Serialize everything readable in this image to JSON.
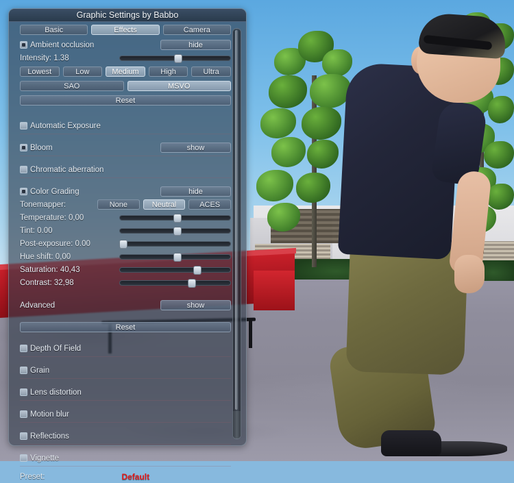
{
  "window": {
    "title": "Graphic Settings by Babbo"
  },
  "tabs": [
    {
      "label": "Basic",
      "active": false
    },
    {
      "label": "Effects",
      "active": true
    },
    {
      "label": "Camera",
      "active": false
    }
  ],
  "ambient_occlusion": {
    "label": "Ambient occlusion",
    "checked": true,
    "toggle_label": "hide",
    "intensity_label": "Intensity: 1.38",
    "intensity_percent": 53,
    "quality": [
      {
        "label": "Lowest",
        "active": false
      },
      {
        "label": "Low",
        "active": false
      },
      {
        "label": "Medium",
        "active": true
      },
      {
        "label": "High",
        "active": false
      },
      {
        "label": "Ultra",
        "active": false
      }
    ],
    "methods": [
      {
        "label": "SAO",
        "active": false
      },
      {
        "label": "MSVO",
        "active": true
      }
    ],
    "reset_label": "Reset"
  },
  "automatic_exposure": {
    "label": "Automatic Exposure",
    "checked": false
  },
  "bloom": {
    "label": "Bloom",
    "checked": true,
    "toggle_label": "show"
  },
  "chromatic_aberration": {
    "label": "Chromatic aberration",
    "checked": false
  },
  "color_grading": {
    "label": "Color Grading",
    "checked": true,
    "toggle_label": "hide",
    "tonemapper_label": "Tonemapper:",
    "tonemappers": [
      {
        "label": "None",
        "active": false
      },
      {
        "label": "Neutral",
        "active": true
      },
      {
        "label": "ACES",
        "active": false
      }
    ],
    "sliders": [
      {
        "label": "Temperature: 0,00",
        "percent": 52
      },
      {
        "label": "Tint: 0.00",
        "percent": 52
      },
      {
        "label": "Post-exposure: 0.00",
        "percent": 3
      },
      {
        "label": "Hue shift: 0,00",
        "percent": 52
      },
      {
        "label": "Saturation: 40,43",
        "percent": 70
      },
      {
        "label": "Contrast: 32,98",
        "percent": 65
      }
    ],
    "advanced_label": "Advanced",
    "advanced_toggle_label": "show",
    "reset_label": "Reset"
  },
  "effects": [
    {
      "label": "Depth Of Field",
      "checked": false
    },
    {
      "label": "Grain",
      "checked": false
    },
    {
      "label": "Lens distortion",
      "checked": false
    },
    {
      "label": "Motion blur",
      "checked": false
    },
    {
      "label": "Reflections",
      "checked": false
    },
    {
      "label": "Vignette",
      "checked": false
    }
  ],
  "preset": {
    "label": "Preset:",
    "value": "Default",
    "value_color": "#e01a1a"
  }
}
